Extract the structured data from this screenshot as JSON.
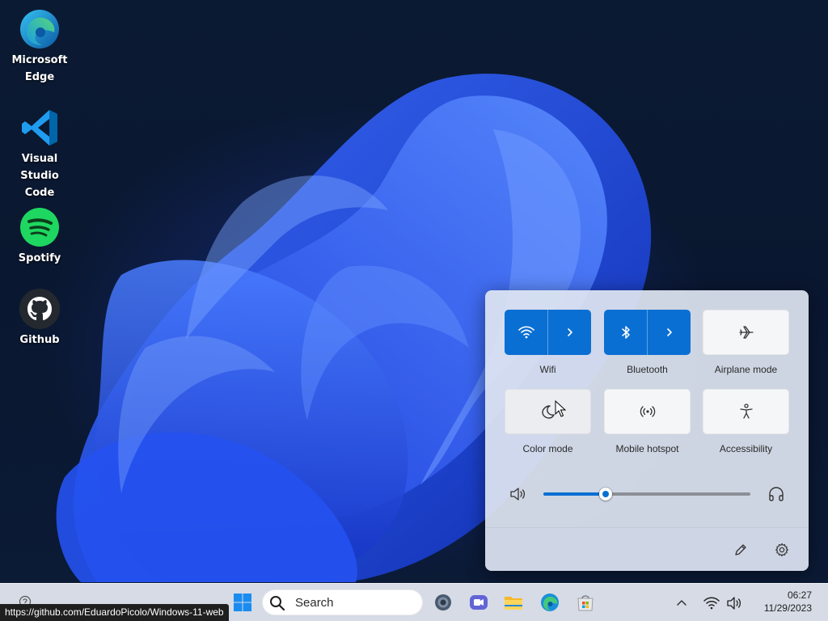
{
  "desktop": {
    "icons": [
      {
        "label": "Microsoft\nEdge",
        "icon": "edge-icon"
      },
      {
        "label": "Visual Studio\nCode",
        "icon": "vscode-icon"
      },
      {
        "label": "Spotify",
        "icon": "spotify-icon"
      },
      {
        "label": "Github",
        "icon": "github-icon"
      }
    ]
  },
  "quick_settings": {
    "tiles": [
      {
        "label": "Wifi",
        "icon": "wifi-icon",
        "active": true,
        "has_arrow": true
      },
      {
        "label": "Bluetooth",
        "icon": "bluetooth-icon",
        "active": true,
        "has_arrow": true
      },
      {
        "label": "Airplane mode",
        "icon": "airplane-icon",
        "active": false
      },
      {
        "label": "Color mode",
        "icon": "moon-icon",
        "active": false
      },
      {
        "label": "Mobile hotspot",
        "icon": "hotspot-icon",
        "active": false
      },
      {
        "label": "Accessibility",
        "icon": "accessibility-icon",
        "active": false
      }
    ],
    "volume": {
      "level": 0.3,
      "left_icon": "speaker-icon",
      "right_icon": "headphones-icon"
    },
    "footer": {
      "edit_icon": "pencil-icon",
      "settings_icon": "gear-icon"
    }
  },
  "taskbar": {
    "search_label": "Search",
    "apps": [
      "windows-start-icon",
      "settings-icon",
      "teams-meet-icon",
      "file-explorer-icon",
      "edge-icon",
      "store-icon"
    ],
    "tray": {
      "chevron_icon": "chevron-up-icon",
      "wifi_icon": "wifi-icon",
      "volume_icon": "speaker-icon"
    },
    "time": "06:27",
    "date": "11/29/2023"
  },
  "status_url": "https://github.com/EduardoPicolo/Windows-11-web",
  "colors": {
    "accent": "#0a6fd3",
    "desktop_bg": "#0b1a33",
    "panel_bg": "#dee4f0",
    "taskbar_bg": "#e1e6f0"
  }
}
